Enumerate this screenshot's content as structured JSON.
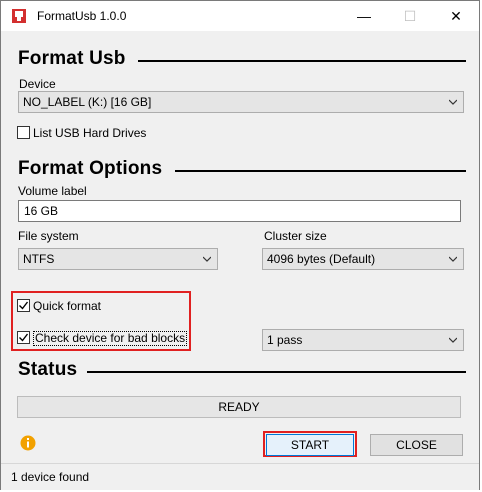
{
  "window": {
    "title": "FormatUsb 1.0.0",
    "minimize_glyph": "—",
    "maximize_glyph": "☐",
    "close_glyph": "✕"
  },
  "format_usb": {
    "heading": "Format Usb",
    "device_label": "Device",
    "device_value": "NO_LABEL (K:) [16 GB]",
    "list_usb_label": "List USB Hard Drives",
    "list_usb_checked": false
  },
  "format_options": {
    "heading": "Format Options",
    "volume_label_label": "Volume label",
    "volume_label_value": "16 GB",
    "file_system_label": "File system",
    "file_system_value": "NTFS",
    "cluster_size_label": "Cluster size",
    "cluster_size_value": "4096 bytes (Default)",
    "quick_format_label": "Quick format",
    "quick_format_checked": true,
    "bad_blocks_label": "Check device for bad blocks",
    "bad_blocks_checked": true,
    "passes_value": "1 pass"
  },
  "status": {
    "heading": "Status",
    "progress_text": "READY",
    "start_label": "START",
    "close_label": "CLOSE",
    "statusbar_text": "1 device found"
  },
  "colors": {
    "highlight": "#e02020",
    "info_icon": "#f2a100",
    "app_icon": "#d32f2f"
  },
  "icons": {
    "app": "usb-format-app-icon",
    "info": "info-icon"
  }
}
